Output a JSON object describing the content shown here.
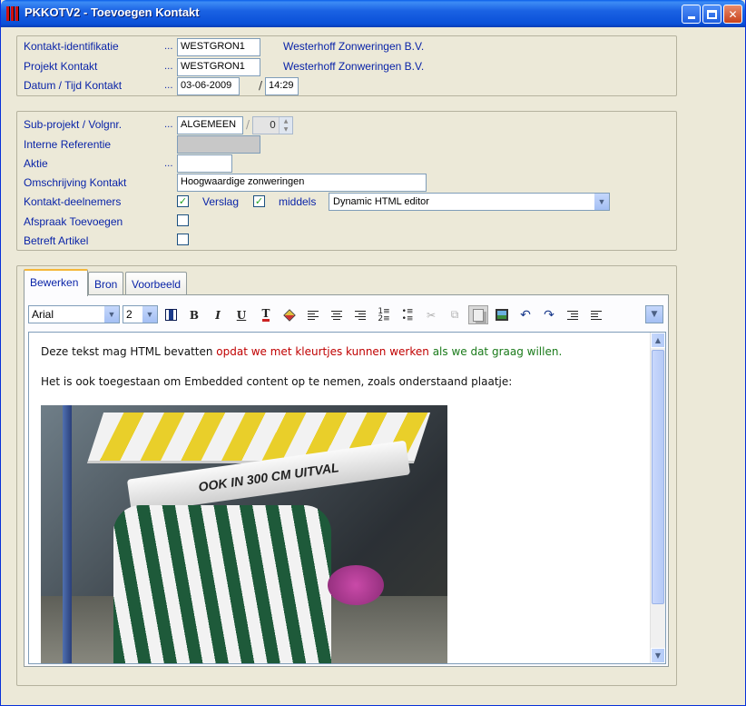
{
  "window": {
    "title": "PKKOTV2 - Toevoegen Kontakt",
    "controls": {
      "minimize": "minimize",
      "maximize": "maximize",
      "close": "✕"
    }
  },
  "contact": {
    "id_label": "Kontakt-identifikatie",
    "id_value": "WESTGRON1",
    "id_company": "Westerhoff Zonweringen B.V.",
    "project_label": "Projekt Kontakt",
    "project_value": "WESTGRON1",
    "project_company": "Westerhoff Zonweringen B.V.",
    "datetime_label": "Datum / Tijd Kontakt",
    "date_value": "03-06-2009",
    "time_value": "14:29",
    "dots": "...",
    "slash": "/"
  },
  "details": {
    "subproject_label": "Sub-projekt / Volgnr.",
    "subproject_value": "ALGEMEEN",
    "volgnr_value": "0",
    "interne_label": "Interne Referentie",
    "aktie_label": "Aktie",
    "omschrijving_label": "Omschrijving Kontakt",
    "omschrijving_value": "Hoogwaardige zonweringen",
    "deelnemers_label": "Kontakt-deelnemers",
    "verslag_label": "Verslag",
    "middels_label": "middels",
    "middels_value": "Dynamic HTML editor",
    "afspraak_label": "Afspraak Toevoegen",
    "artikel_label": "Betreft Artikel",
    "check_mark": "✓"
  },
  "tabs": [
    {
      "label": "Bewerken",
      "active": true
    },
    {
      "label": "Bron",
      "active": false
    },
    {
      "label": "Voorbeeld",
      "active": false
    }
  ],
  "toolbar": {
    "font": "Arial",
    "size": "2",
    "bold": "B",
    "italic": "I",
    "underline": "U"
  },
  "editor": {
    "line1_a": "Deze tekst mag HTML bevatten ",
    "line1_red": "opdat we met kleurtjes kunnen werken",
    "line1_green": " als we dat graag willen.",
    "line2": "Het is ook toegestaan om Embedded content op te nemen, zoals onderstaand plaatje:",
    "image_caption": "OOK IN 300 CM UITVAL"
  }
}
